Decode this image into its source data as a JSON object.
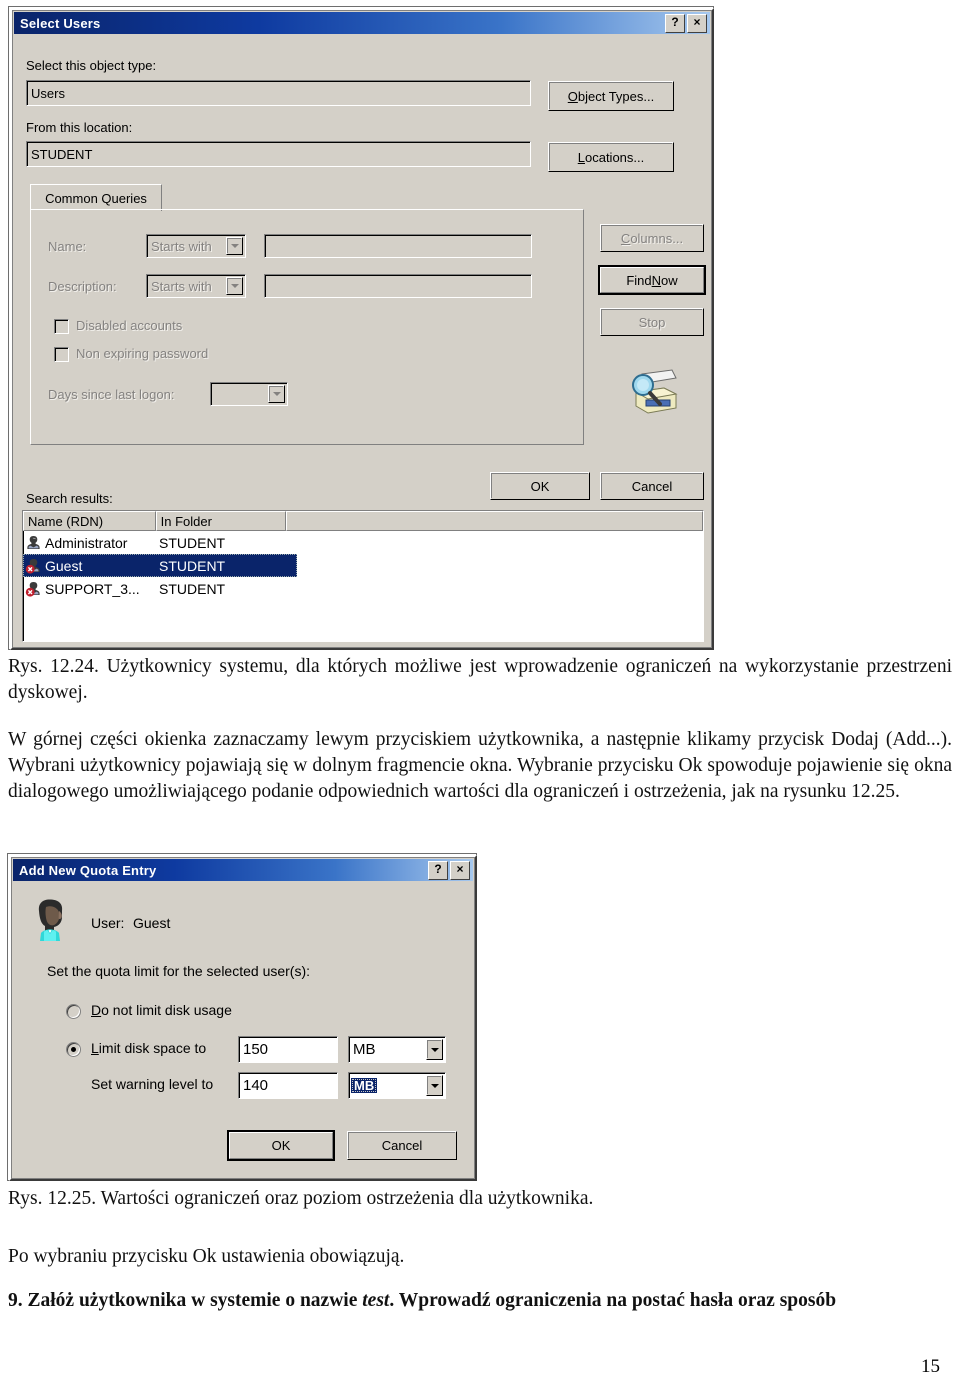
{
  "select_users_dialog": {
    "title": "Select Users",
    "help_button": "?",
    "close_button": "×",
    "object_type_label": "Select this object type:",
    "object_type_value": "Users",
    "object_types_button": "Object Types...",
    "location_label": "From this location:",
    "location_value": "STUDENT",
    "locations_button": "Locations...",
    "tab_common_queries": "Common Queries",
    "name_label": "Name:",
    "name_condition": "Starts with",
    "name_value": "",
    "description_label": "Description:",
    "description_condition": "Starts with",
    "description_value": "",
    "disabled_accounts_label": "Disabled accounts",
    "non_expiring_password_label": "Non expiring password",
    "days_since_last_logon_label": "Days since last logon:",
    "days_since_last_logon_value": "",
    "columns_button": "Columns...",
    "find_now_button": "Find Now",
    "stop_button": "Stop",
    "search_results_label": "Search results:",
    "columns": [
      "Name (RDN)",
      "In Folder"
    ],
    "rows": [
      {
        "name": "Administrator",
        "folder": "STUDENT",
        "selected": false,
        "icon": "user-icon"
      },
      {
        "name": "Guest",
        "folder": "STUDENT",
        "selected": true,
        "icon": "user-disabled-icon"
      },
      {
        "name": "SUPPORT_3...",
        "folder": "STUDENT",
        "selected": false,
        "icon": "user-disabled-icon"
      }
    ],
    "ok_button": "OK",
    "cancel_button": "Cancel"
  },
  "caption_1224": "Rys. 12.24. Użytkownicy systemu, dla których możliwe jest wprowadzenie ograniczeń na wykorzystanie przestrzeni dyskowej.",
  "body_paragraph_1": "W górnej części okienka zaznaczamy lewym przyciskiem użytkownika, a następnie klikamy przycisk Dodaj (Add...). Wybrani użytkownicy pojawiają się w dolnym fragmencie okna. Wybranie przycisku Ok spowoduje pojawienie się okna dialogowego umożliwiającego podanie odpowiednich wartości dla ograniczeń i ostrzeżenia, jak na rysunku 12.25.",
  "quota_dialog": {
    "title": "Add New Quota Entry",
    "help_button": "?",
    "close_button": "×",
    "user_label": "User:",
    "user_name": "Guest",
    "instruction": "Set the quota limit for the selected user(s):",
    "option_no_limit": "Do not limit disk usage",
    "option_limit_to": "Limit disk space to",
    "limit_value": "150",
    "limit_unit": "MB",
    "warning_label": "Set warning level to",
    "warning_value": "140",
    "warning_unit": "MB",
    "ok_button": "OK",
    "cancel_button": "Cancel"
  },
  "caption_1225": "Rys. 12.25. Wartości ograniczeń oraz poziom ostrzeżenia dla użytkownika.",
  "body_paragraph_2": "Po wybraniu przycisku Ok ustawienia obowiązują.",
  "task_9": {
    "prefix": "9. Załóż użytkownika w systemie o nazwie ",
    "emphasis": "test",
    "suffix": ". Wprowadź ograniczenia na postać hasła oraz sposób"
  },
  "page_number": "15"
}
